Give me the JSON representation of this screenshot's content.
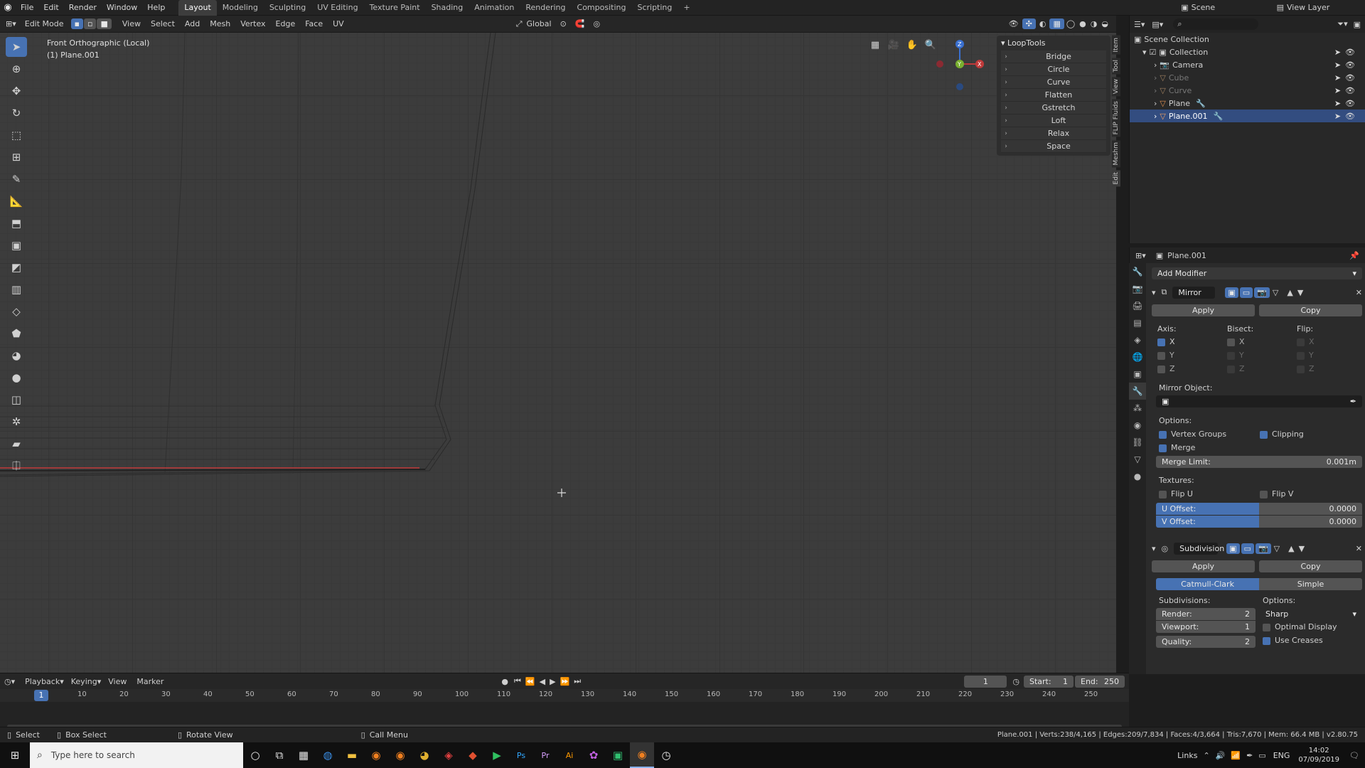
{
  "topbar": {
    "menus": [
      "File",
      "Edit",
      "Render",
      "Window",
      "Help"
    ],
    "workspaces": [
      "Layout",
      "Modeling",
      "Sculpting",
      "UV Editing",
      "Texture Paint",
      "Shading",
      "Animation",
      "Rendering",
      "Compositing",
      "Scripting"
    ],
    "active_workspace": "Layout",
    "scene": "Scene",
    "view_layer": "View Layer"
  },
  "viewport_header": {
    "mode": "Edit Mode",
    "menus": [
      "View",
      "Select",
      "Add",
      "Mesh",
      "Vertex",
      "Edge",
      "Face",
      "UV"
    ],
    "orientation": "Global"
  },
  "viewport": {
    "view_name": "Front Orthographic (Local)",
    "object_name": "(1) Plane.001",
    "gizmo_x": "X",
    "gizmo_y": "Y",
    "gizmo_z": "Z"
  },
  "looptools": {
    "title": "LoopTools",
    "items": [
      "Bridge",
      "Circle",
      "Curve",
      "Flatten",
      "Gstretch",
      "Loft",
      "Relax",
      "Space"
    ]
  },
  "sidebar_tabs": [
    "Item",
    "Tool",
    "View",
    "FLIP Fluids",
    "Meshm",
    "Edit"
  ],
  "outliner": {
    "root": "Scene Collection",
    "collection": "Collection",
    "items": [
      {
        "name": "Camera",
        "selected": false
      },
      {
        "name": "Cube",
        "selected": false
      },
      {
        "name": "Curve",
        "selected": false
      },
      {
        "name": "Plane",
        "selected": false
      },
      {
        "name": "Plane.001",
        "selected": true
      }
    ]
  },
  "properties": {
    "object": "Plane.001",
    "add_modifier": "Add Modifier",
    "mirror": {
      "name": "Mirror",
      "apply": "Apply",
      "copy": "Copy",
      "axis_label": "Axis:",
      "bisect_label": "Bisect:",
      "flip_label": "Flip:",
      "x": "X",
      "y": "Y",
      "z": "Z",
      "mirror_object_label": "Mirror Object:",
      "options_label": "Options:",
      "vertex_groups": "Vertex Groups",
      "clipping": "Clipping",
      "merge": "Merge",
      "merge_limit_label": "Merge Limit:",
      "merge_limit": "0.001m",
      "textures_label": "Textures:",
      "flip_u": "Flip U",
      "flip_v": "Flip V",
      "u_offset_label": "U Offset:",
      "u_offset": "0.0000",
      "v_offset_label": "V Offset:",
      "v_offset": "0.0000"
    },
    "subdivision": {
      "name": "Subdivision",
      "apply": "Apply",
      "copy": "Copy",
      "catmull": "Catmull-Clark",
      "simple": "Simple",
      "subdivisions_label": "Subdivisions:",
      "options_label": "Options:",
      "render_label": "Render:",
      "render": "2",
      "viewport_label": "Viewport:",
      "viewport": "1",
      "quality_label": "Quality:",
      "quality": "2",
      "sharp": "Sharp",
      "optimal_display": "Optimal Display",
      "use_creases": "Use Creases"
    }
  },
  "timeline": {
    "menus": [
      "Playback",
      "Keying",
      "View",
      "Marker"
    ],
    "current_frame": "1",
    "start_label": "Start:",
    "start": "1",
    "end_label": "End:",
    "end": "250",
    "ticks": [
      "10",
      "20",
      "30",
      "40",
      "50",
      "60",
      "70",
      "80",
      "90",
      "100",
      "110",
      "120",
      "130",
      "140",
      "150",
      "160",
      "170",
      "180",
      "190",
      "200",
      "210",
      "220",
      "230",
      "240",
      "250"
    ],
    "playhead": "1"
  },
  "statusbar": {
    "select": "Select",
    "box_select": "Box Select",
    "rotate_view": "Rotate View",
    "call_menu": "Call Menu",
    "stats": "Plane.001 | Verts:238/4,165 | Edges:209/7,834 | Faces:4/3,664 | Tris:7,670 | Mem: 66.4 MB | v2.80.75"
  },
  "taskbar": {
    "search_placeholder": "Type here to search",
    "links": "Links",
    "lang": "ENG",
    "time": "14:02",
    "date": "07/09/2019"
  },
  "colors": {
    "accent": "#4772b3",
    "selected_row": "#334d80",
    "edge_red": "#c03a3a"
  }
}
